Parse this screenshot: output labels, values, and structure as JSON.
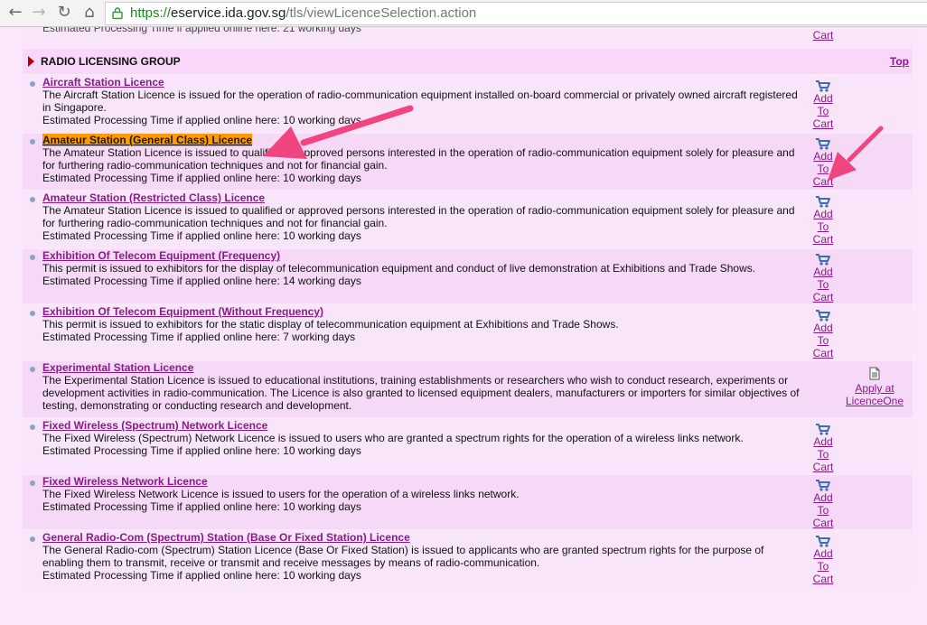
{
  "browser": {
    "url_scheme": "https://",
    "url_host": "eservice.ida.gov.sg",
    "url_path": "/tls/viewLicenceSelection.action"
  },
  "cut_row": {
    "text": "Estimated Processing Time if applied online here: 21 working days",
    "cart_label": "Cart"
  },
  "group": {
    "title": "RADIO LICENSING GROUP",
    "top_label": "Top"
  },
  "licences": [
    {
      "title": "Aircraft Station Licence",
      "desc": "The Aircraft Station Licence is issued for the operation of radio-communication equipment installed on-board commercial or privately owned aircraft registered in Singapore.",
      "proc": "Estimated Processing Time if applied online here: 10 working days",
      "action": "cart"
    },
    {
      "title": "Amateur Station (General Class) Licence",
      "desc": "The Amateur Station Licence is issued to qualified or approved persons interested in the operation of radio-communication equipment solely for pleasure and for furthering radio-communication techniques and not for financial gain.",
      "proc": "Estimated Processing Time if applied online here: 10 working days",
      "action": "cart",
      "highlight": true
    },
    {
      "title": "Amateur Station (Restricted Class) Licence",
      "desc": "The Amateur Station Licence is issued to qualified or approved persons interested in the operation of radio-communication equipment solely for pleasure and for furthering radio-communication techniques and not for financial gain.",
      "proc": "Estimated Processing Time if applied online here: 10 working days",
      "action": "cart"
    },
    {
      "title": "Exhibition Of Telecom Equipment (Frequency)",
      "desc": "This permit is issued to exhibitors for the display of telecommunication equipment and conduct of live demonstration at Exhibitions and Trade Shows.",
      "proc": "Estimated Processing Time if applied online here: 14 working days",
      "action": "cart"
    },
    {
      "title": "Exhibition Of Telecom Equipment (Without Frequency)",
      "desc": "This permit is issued to exhibitors for the static display of telecommunication equipment at Exhibitions and Trade Shows.",
      "proc": "Estimated Processing Time if applied online here: 7 working days",
      "action": "cart"
    },
    {
      "title": "Experimental Station Licence",
      "desc": "The Experimental Station Licence is issued to educational institutions, training establishments or researchers who wish to conduct research, experiments or development activities in radio-communication. The Licence is also granted to licensed equipment dealers, manufacturers or importers for similar objectives of testing, demonstrating or conducting research and development.",
      "proc": "",
      "action": "apply"
    },
    {
      "title": "Fixed Wireless (Spectrum) Network Licence",
      "desc": "The Fixed Wireless (Spectrum) Network Licence is issued to users who are granted a spectrum rights for the operation of a wireless links network.",
      "proc": "Estimated Processing Time if applied online here: 10 working days",
      "action": "cart"
    },
    {
      "title": "Fixed Wireless Network Licence",
      "desc": "The Fixed Wireless Network Licence is issued to users for the operation of a wireless links network.",
      "proc": "Estimated Processing Time if applied online here: 10 working days",
      "action": "cart"
    },
    {
      "title": "General Radio-Com (Spectrum) Station (Base Or Fixed Station) Licence",
      "desc": "The General Radio-com (Spectrum) Station Licence (Base Or Fixed Station) is issued to applicants who are granted spectrum rights for the purpose of enabling them to transmit, receive or transmit and receive messages by means of radio-communication.",
      "proc": "Estimated Processing Time if applied online here: 10 working days",
      "action": "cart"
    }
  ],
  "cart": {
    "add": "Add",
    "to": "To",
    "cart": "Cart"
  },
  "apply": {
    "line1": "Apply at",
    "line2": "LicenceOne"
  },
  "colors": {
    "page_bg": "#fbe7fb",
    "link": "#8a1a8a",
    "highlight": "#ff9a00",
    "annotation_arrow": "#f0457f"
  },
  "icons": {
    "back": "left-arrow-icon",
    "forward": "right-arrow-icon",
    "reload": "reload-icon",
    "home": "home-icon",
    "lock": "lock-icon",
    "cart": "shopping-cart-icon",
    "document": "document-icon"
  }
}
